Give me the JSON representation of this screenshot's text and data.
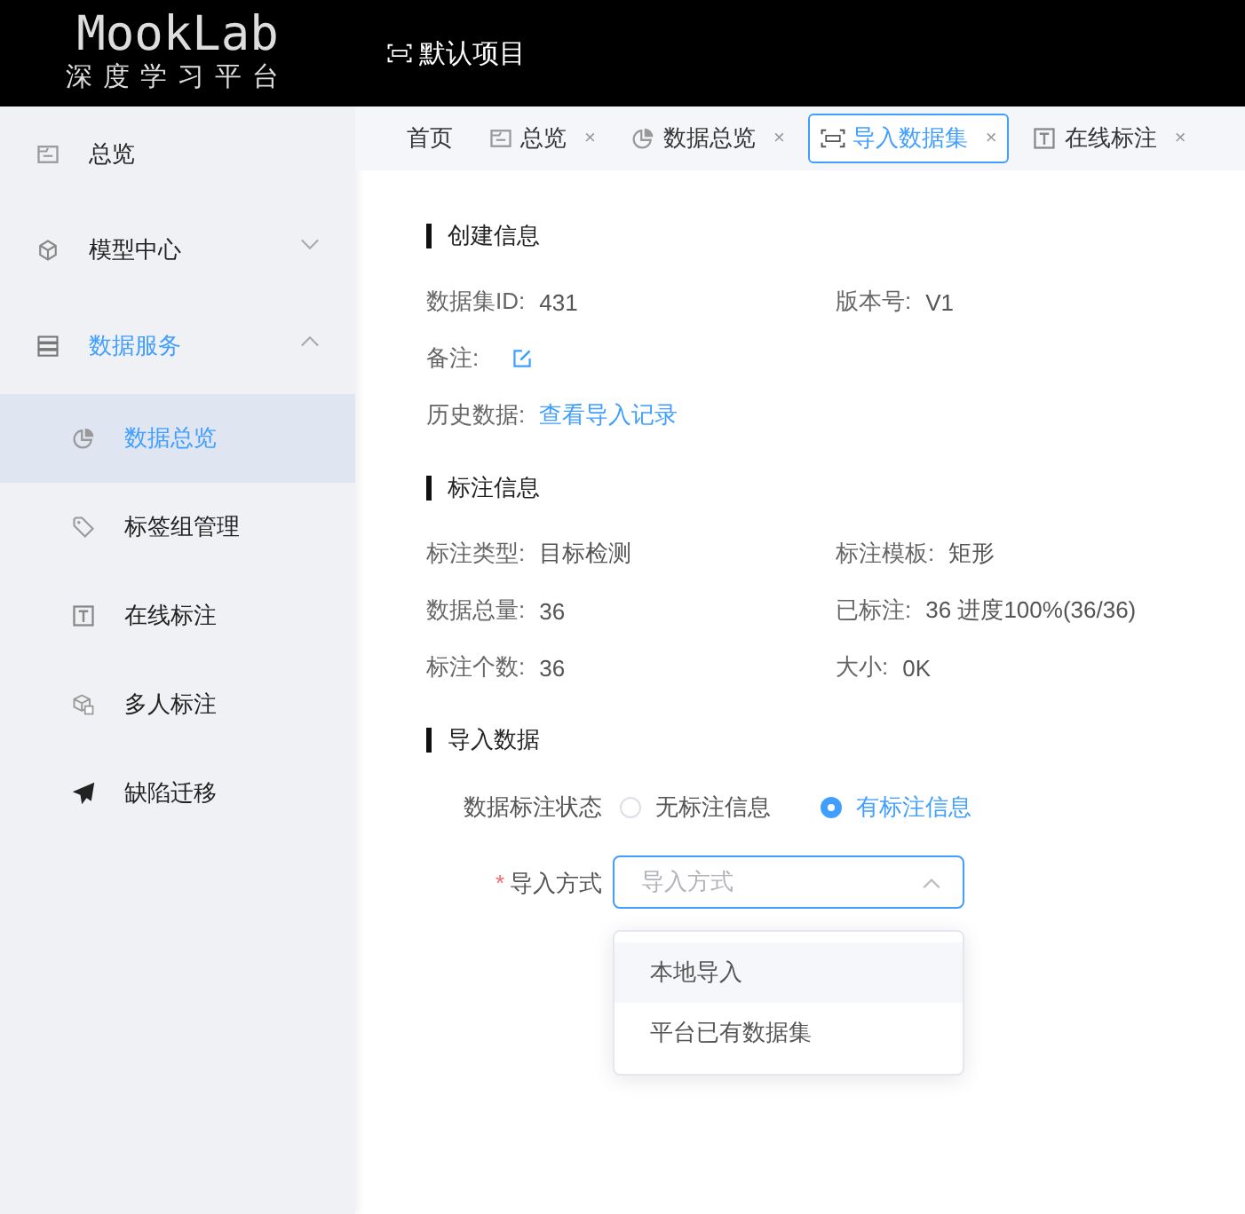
{
  "header": {
    "logo": "MookLab",
    "subtitle": "深度学习平台",
    "project": "默认项目"
  },
  "sidebar": {
    "items": [
      {
        "label": "总览",
        "selected": false
      },
      {
        "label": "模型中心",
        "selected": false,
        "expanded": false
      },
      {
        "label": "数据服务",
        "selected": true,
        "expanded": true,
        "children": [
          {
            "label": "数据总览",
            "selected": true
          },
          {
            "label": "标签组管理",
            "selected": false
          },
          {
            "label": "在线标注",
            "selected": false
          },
          {
            "label": "多人标注",
            "selected": false
          },
          {
            "label": "缺陷迁移",
            "selected": false
          }
        ]
      }
    ]
  },
  "tabs": [
    {
      "label": "首页",
      "selected": false,
      "closable": false
    },
    {
      "label": "总览",
      "selected": false,
      "closable": true
    },
    {
      "label": "数据总览",
      "selected": false,
      "closable": true
    },
    {
      "label": "导入数据集",
      "selected": true,
      "closable": true
    },
    {
      "label": "在线标注",
      "selected": false,
      "closable": true
    }
  ],
  "close_glyph": "×",
  "sections": [
    {
      "title": "创建信息",
      "rows": [
        [
          {
            "kind": "text",
            "label": "数据集ID:",
            "value": "431"
          },
          {
            "kind": "text",
            "label": "版本号:",
            "value": "V1"
          }
        ],
        [
          {
            "kind": "edit",
            "label": "备注:"
          }
        ],
        [
          {
            "kind": "link",
            "label": "历史数据:",
            "value": "查看导入记录"
          }
        ]
      ]
    },
    {
      "title": "标注信息",
      "rows": [
        [
          {
            "kind": "text",
            "label": "标注类型:",
            "value": "目标检测"
          },
          {
            "kind": "text",
            "label": "标注模板:",
            "value": "矩形"
          }
        ],
        [
          {
            "kind": "text",
            "label": "数据总量:",
            "value": "36"
          },
          {
            "kind": "text",
            "label": "已标注:",
            "value": "36 进度100%(36/36)"
          }
        ],
        [
          {
            "kind": "text",
            "label": "标注个数:",
            "value": "36"
          },
          {
            "kind": "text",
            "label": "大小:",
            "value": "0K"
          }
        ]
      ]
    },
    {
      "title": "导入数据"
    }
  ],
  "form": {
    "status_label": "数据标注状态",
    "radios": [
      {
        "label": "无标注信息",
        "selected": false
      },
      {
        "label": "有标注信息",
        "selected": true
      }
    ],
    "method_label": "导入方式",
    "required_mark": "*",
    "method_placeholder": "导入方式",
    "dropdown_open": true,
    "options": [
      {
        "label": "本地导入",
        "selected": true
      },
      {
        "label": "平台已有数据集",
        "selected": false
      }
    ]
  }
}
